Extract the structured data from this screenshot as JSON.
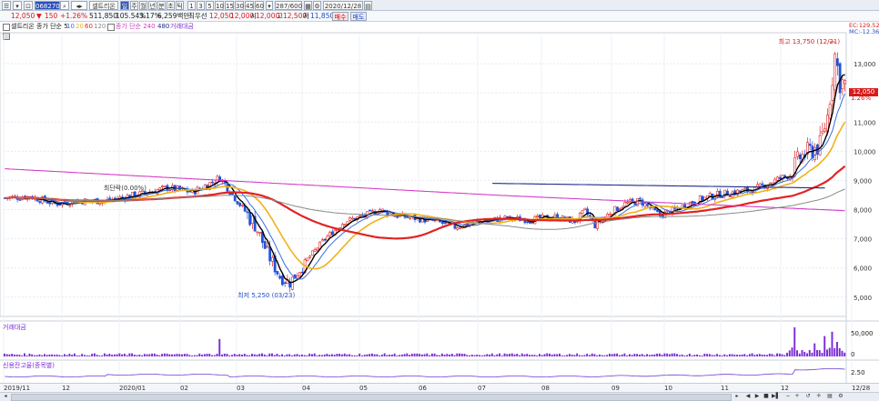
{
  "toolbar": {
    "code": "068270",
    "name": "셀트리온",
    "main_tabs": [
      "주",
      "월",
      "년",
      "분",
      "초",
      "틱"
    ],
    "intervals": [
      "1",
      "3",
      "5",
      "10",
      "15",
      "30",
      "45",
      "60"
    ],
    "counter": "287/600",
    "date": "2020/12/28"
  },
  "quote": {
    "price": "12,050",
    "change_arrow": "▼",
    "change": "150",
    "change_sign": "+1.26%",
    "volume": "511,850",
    "vol_ratio": "105.54%",
    "turnover": "3.17%",
    "amount": "6,259백만",
    "prev_label": "최우선",
    "prev_val": "12,050",
    "open_label": "",
    "open_val": "12,000",
    "ask_label": "시",
    "ask_val": "12,000",
    "high_label": "고",
    "high_val": "12,500",
    "low_label": "저",
    "low_val": "11,850",
    "buy": "매수",
    "sell": "매도"
  },
  "legend": {
    "stock_name": "셀트리온",
    "ma_label": "종가 단순 5",
    "ma_periods": [
      "10",
      "20",
      "60",
      "120"
    ],
    "ma2_label": "종가 단순 240",
    "ma2_period": "480",
    "vol_label": "거래대금"
  },
  "colors": {
    "up": "#e02424",
    "down": "#2353d8",
    "ma5": "#000000",
    "ma10": "#3a6fe0",
    "ma20": "#f0b21a",
    "ma60": "#e22222",
    "ma120": "#8a8a8a",
    "ma240": "#d43cc7",
    "ma480": "#1e2c8a"
  },
  "right_labels": {
    "top1": "EC:129.52",
    "top2": "MC:-12.36",
    "price_box": "12,050",
    "price_pct": "1.26%"
  },
  "chart_data": [
    {
      "type": "candlestick",
      "panel": "price",
      "y_ticks": [
        5000,
        6000,
        7000,
        8000,
        9000,
        10000,
        11000,
        12000,
        13000
      ],
      "y_tick_labels": [
        "5,000",
        "6,000",
        "7,000",
        "8,000",
        "9,000",
        "10,000",
        "11,000",
        "12,000",
        "13,000"
      ],
      "ylim": [
        4400,
        14000
      ],
      "x_labels": [
        "2019/11",
        "12",
        "2020/01",
        "02",
        "03",
        "04",
        "05",
        "06",
        "07",
        "08",
        "09",
        "10",
        "11",
        "12",
        "12/28"
      ],
      "annotations": {
        "high": "최고 13,750 (12/21)",
        "low": "최저 5,250 (03/23)",
        "mid": "최단락(0.00%)"
      },
      "anchors": [
        [
          0,
          8400
        ],
        [
          10,
          8450
        ],
        [
          20,
          8200
        ],
        [
          30,
          8300
        ],
        [
          40,
          8300
        ],
        [
          55,
          8550
        ],
        [
          65,
          8750
        ],
        [
          75,
          8600
        ],
        [
          82,
          8900
        ],
        [
          86,
          9100
        ],
        [
          92,
          8400
        ],
        [
          100,
          7500
        ],
        [
          105,
          6500
        ],
        [
          110,
          5700
        ],
        [
          114,
          5500
        ],
        [
          120,
          6200
        ],
        [
          128,
          7000
        ],
        [
          136,
          7600
        ],
        [
          144,
          7800
        ],
        [
          150,
          8000
        ],
        [
          156,
          7800
        ],
        [
          164,
          7700
        ],
        [
          172,
          7600
        ],
        [
          180,
          7400
        ],
        [
          190,
          7600
        ],
        [
          200,
          7700
        ],
        [
          210,
          7650
        ],
        [
          220,
          7750
        ],
        [
          228,
          7600
        ],
        [
          232,
          7950
        ],
        [
          236,
          7450
        ],
        [
          242,
          7900
        ],
        [
          248,
          8200
        ],
        [
          254,
          8300
        ],
        [
          262,
          7800
        ],
        [
          268,
          8000
        ],
        [
          276,
          8300
        ],
        [
          284,
          8500
        ],
        [
          292,
          8600
        ],
        [
          300,
          8700
        ],
        [
          308,
          9000
        ],
        [
          314,
          9200
        ],
        [
          318,
          9800
        ],
        [
          322,
          10000
        ],
        [
          326,
          10200
        ],
        [
          329,
          11200
        ],
        [
          332,
          13300
        ],
        [
          334,
          12400
        ],
        [
          336,
          12300
        ]
      ],
      "n_candles": 337,
      "ma5": "black",
      "ma10": "blue",
      "ma20": "orange",
      "ma60": "red",
      "ma120": "gray",
      "ma240": "magenta",
      "ma480": "navy"
    },
    {
      "type": "bar",
      "panel": "volume",
      "label": "거래대금",
      "y_tick_labels": [
        "50,000",
        "0"
      ],
      "spikes": [
        [
          86,
          0.6
        ],
        [
          316,
          1.0
        ],
        [
          324,
          0.45
        ],
        [
          328,
          0.7
        ],
        [
          331,
          0.85
        ],
        [
          333,
          0.5
        ]
      ]
    },
    {
      "type": "line",
      "panel": "credit",
      "label": "신용잔고율(종목별)",
      "y_tick_labels": [
        "2.50"
      ]
    }
  ]
}
